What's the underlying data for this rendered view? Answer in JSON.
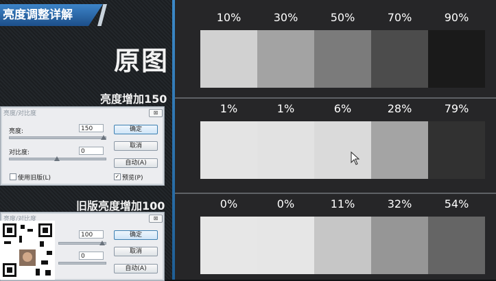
{
  "banner": {
    "title": "亮度调整详解"
  },
  "left": {
    "original_title": "原图",
    "section1_label": "亮度增加150",
    "section2_label": "旧版亮度增加100"
  },
  "dialog1": {
    "title": "亮度/对比度",
    "close": "⊠",
    "brightness_label": "亮度:",
    "brightness_value": "150",
    "contrast_label": "对比度:",
    "contrast_value": "0",
    "ok": "确定",
    "cancel": "取消",
    "auto": "自动(A)",
    "legacy_label": "使用旧版(L)",
    "legacy_checked": false,
    "preview_label": "预览(P)",
    "preview_checked": true
  },
  "dialog2": {
    "title": "亮度/对比度",
    "close": "⊠",
    "brightness_value": "100",
    "contrast_value": "0",
    "ok": "确定",
    "cancel": "取消",
    "auto": "自动(A)"
  },
  "rows": [
    {
      "labels": [
        "10%",
        "30%",
        "50%",
        "70%",
        "90%"
      ],
      "colors": [
        "#d1d1d1",
        "#a3a3a3",
        "#7b7b7b",
        "#4c4c4c",
        "#1a1a1a"
      ]
    },
    {
      "labels": [
        "1%",
        "1%",
        "6%",
        "28%",
        "79%"
      ],
      "colors": [
        "#e4e4e4",
        "#e2e2e2",
        "#dadada",
        "#a4a4a4",
        "#313131"
      ]
    },
    {
      "labels": [
        "0%",
        "0%",
        "11%",
        "32%",
        "54%"
      ],
      "colors": [
        "#e7e7e7",
        "#e6e6e6",
        "#c6c6c6",
        "#969696",
        "#656565"
      ]
    }
  ],
  "colors": {
    "accent_blue": "#2f6fb0",
    "right_bg": "#262628"
  },
  "icons": {
    "cursor": "mouse-cursor-icon",
    "qr": "qr-code-icon",
    "close": "close-icon"
  }
}
